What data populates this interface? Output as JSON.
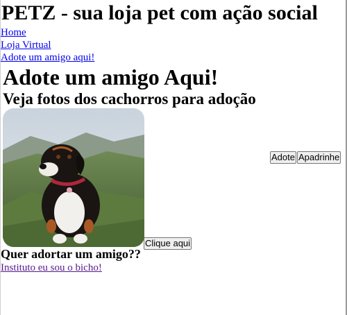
{
  "header": {
    "site_title": "PETZ - sua loja pet com ação social"
  },
  "nav": {
    "items": [
      {
        "label": "Home"
      },
      {
        "label": "Loja Virtual"
      },
      {
        "label": "Adote um amigo aqui!"
      }
    ]
  },
  "main": {
    "title": "Adote um amigo Aqui!",
    "subtitle": "Veja fotos dos cachorros para adoção",
    "buttons": {
      "adote": "Adote",
      "apadrinhe": "Apadrinhe",
      "clique": "Clique aqui"
    },
    "section_title": "Quer adortar um amigo??",
    "partner_link": "Instituto eu sou o bicho!"
  },
  "colors": {
    "link": "#0000ee",
    "visited_link": "#551a8b",
    "background": "#ffffff"
  }
}
